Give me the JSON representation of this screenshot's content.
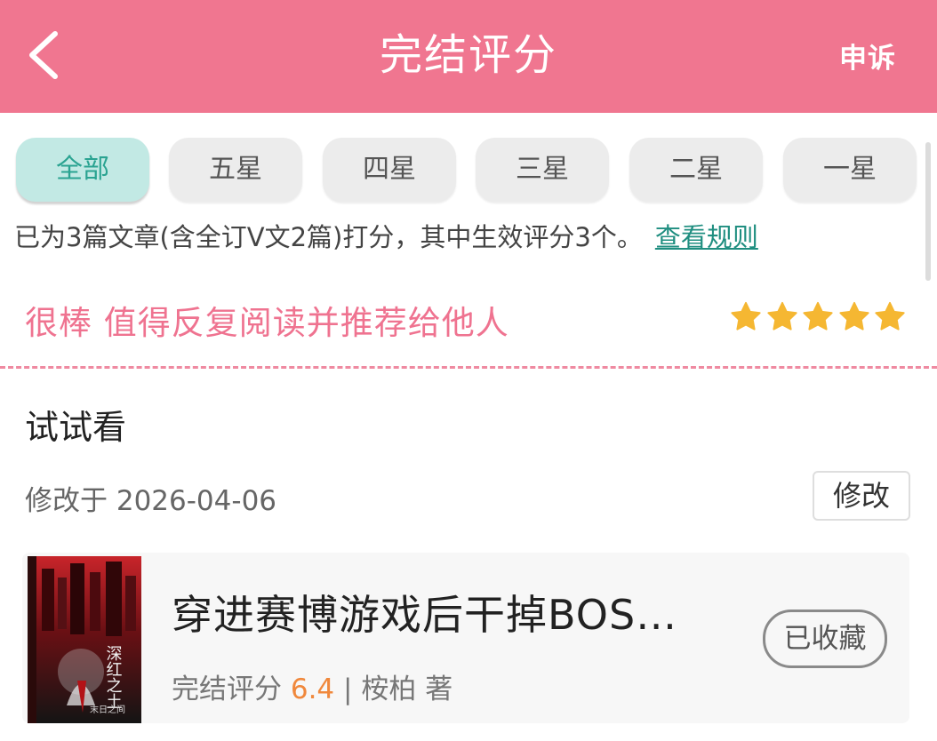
{
  "header": {
    "title": "完结评分",
    "appeal_label": "申诉",
    "background_color": "#f07690"
  },
  "tabs": [
    {
      "label": "全部",
      "active": true
    },
    {
      "label": "五星",
      "active": false
    },
    {
      "label": "四星",
      "active": false
    },
    {
      "label": "三星",
      "active": false
    },
    {
      "label": "二星",
      "active": false
    },
    {
      "label": "一星",
      "active": false
    }
  ],
  "summary": {
    "text": "已为3篇文章(含全订V文2篇)打分，其中生效评分3个。",
    "rules_link": "查看规则"
  },
  "rating": {
    "label": "很棒 值得反复阅读并推荐给他人",
    "stars": 5,
    "max_stars": 5,
    "star_color": "#f5b732"
  },
  "review": {
    "comment": "试试看",
    "modified": "修改于 2026-04-06",
    "edit_label": "修改"
  },
  "book": {
    "title": "穿进赛博游戏后干掉BOS…",
    "score_label": "完结评分",
    "score": "6.4",
    "separator": "|",
    "author": "桉柏 著",
    "collect_label": "已收藏",
    "cover_text": {
      "title_chars": "深红之土",
      "tagline": "末日之间"
    }
  },
  "colors": {
    "accent_pink": "#ef7390",
    "accent_teal": "#2aa391",
    "score_orange": "#f0883c"
  }
}
